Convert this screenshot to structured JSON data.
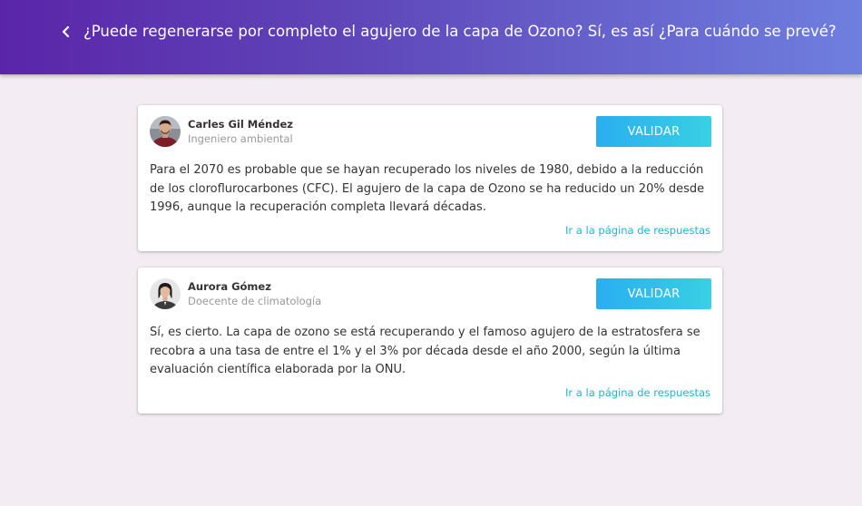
{
  "header": {
    "title": "¿Puede regenerarse por completo el agujero de la capa de Ozono? Sí, es así ¿Para cuándo se prevé?",
    "back_icon": "chevron-left-icon",
    "gradient_start": "#5a25a9",
    "gradient_end": "#6f7fdf"
  },
  "answers": [
    {
      "author": "Carles Gil Méndez",
      "role": "Ingeniero ambiental",
      "validate_label": "VALIDAR",
      "text": "Para el 2070 es probable que se hayan recuperado los niveles de 1980, debido a la reducción de los cloroflurocarbones (CFC). El agujero de la capa de Ozono se ha reducido un 20% desde 1996, aunque la recuperación completa llevará décadas.",
      "link": "Ir a la página de respuestas"
    },
    {
      "author": "Aurora Gómez",
      "role": "Doecente de climatología",
      "validate_label": "VALIDAR",
      "text": "Sí, es cierto. La capa de ozono se está recuperando y el famoso agujero de la estratosfera se recobra a una tasa de entre el 1% y el 3% por década desde el año 2000, según la última evaluación científica elaborada por la ONU.",
      "link": "Ir a la página de respuestas"
    }
  ],
  "colors": {
    "background": "#f3ecf3",
    "accent": "#1fb4d8",
    "button_start": "#2aaef0",
    "button_end": "#39d0e4"
  }
}
